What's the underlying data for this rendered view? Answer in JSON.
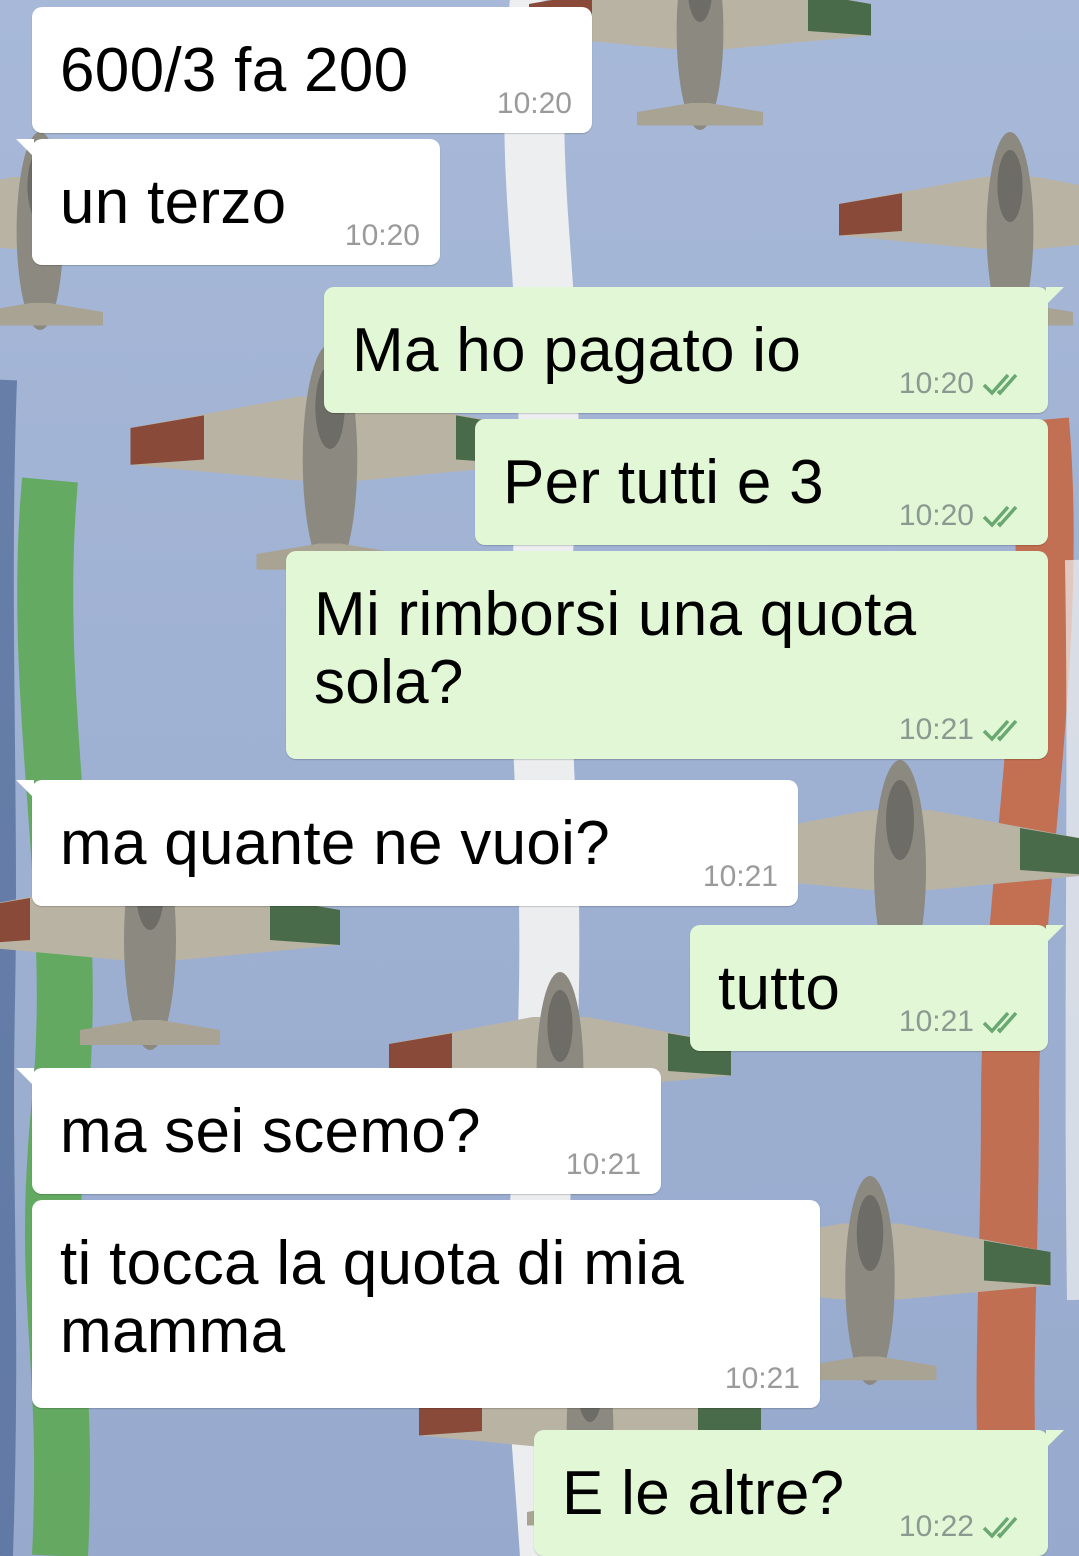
{
  "theme": {
    "incoming_bubble": "#ffffff",
    "outgoing_bubble": "#e1f7d5",
    "read_ticks_color": "#4fc3f7",
    "sky_color": "#9fb2d4"
  },
  "messages": [
    {
      "direction": "in",
      "text": "600/3 fa 200",
      "time": "10:20"
    },
    {
      "direction": "in",
      "text": "un terzo",
      "time": "10:20"
    },
    {
      "direction": "out",
      "text": "Ma ho pagato io",
      "time": "10:20",
      "status_icon": "double-check-icon"
    },
    {
      "direction": "out",
      "text": "Per tutti e 3",
      "time": "10:20",
      "status_icon": "double-check-icon"
    },
    {
      "direction": "out",
      "text": "Mi rimborsi una quota\nsola?",
      "time": "10:21",
      "status_icon": "double-check-icon"
    },
    {
      "direction": "in",
      "text": "ma quante ne vuoi?",
      "time": "10:21"
    },
    {
      "direction": "out",
      "text": "tutto",
      "time": "10:21",
      "status_icon": "double-check-icon"
    },
    {
      "direction": "in",
      "text": "ma sei scemo?",
      "time": "10:21"
    },
    {
      "direction": "in",
      "text": "ti tocca la quota di mia\nmamma",
      "time": "10:21"
    },
    {
      "direction": "out",
      "text": "E le altre?",
      "time": "10:22",
      "status_icon": "double-check-icon"
    }
  ]
}
